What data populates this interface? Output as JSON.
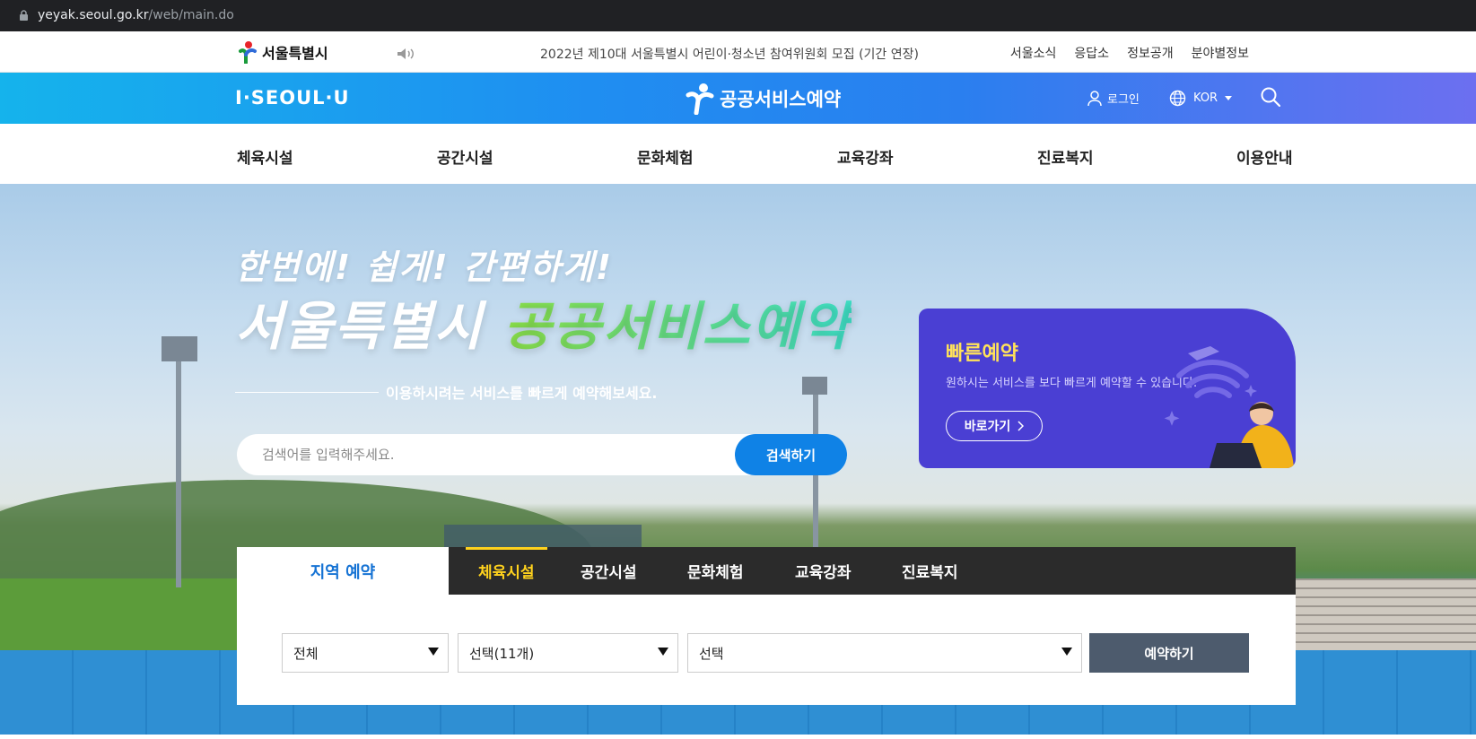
{
  "browser": {
    "url_host": "yeyak.seoul.go.kr",
    "url_path": "/web/main.do"
  },
  "topbar": {
    "logo_text": "서울특별시",
    "notice": "2022년 제10대 서울특별시 어린이·청소년 참여위원회 모집 (기간 연장)",
    "links": [
      "서울소식",
      "응답소",
      "정보공개",
      "분야별정보"
    ]
  },
  "header": {
    "left_logo": "I·SEOUL·U",
    "brand": "공공서비스예약",
    "login": "로그인",
    "lang": "KOR"
  },
  "gnb": [
    "체육시설",
    "공간시설",
    "문화체험",
    "교육강좌",
    "진료복지",
    "이용안내"
  ],
  "hero": {
    "slogan_top": "한번에! 쉽게! 간편하게!",
    "slogan_main": "서울특별시",
    "slogan_highlight": "공공서비스예약",
    "subline": "이용하시려는 서비스를 빠르게 예약해보세요.",
    "search_placeholder": "검색어를 입력해주세요.",
    "search_button": "검색하기"
  },
  "quick": {
    "title": "빠른예약",
    "desc": "원하시는 서비스를 보다 빠르게 예약할 수 있습니다.",
    "button": "바로가기"
  },
  "region_panel": {
    "region_tab": "지역 예약",
    "tabs": [
      "체육시설",
      "공간시설",
      "문화체험",
      "교육강좌",
      "진료복지"
    ],
    "active_tab": "체육시설",
    "select_area": "전체",
    "select_category": "선택(11개)",
    "select_facility": "선택",
    "reserve_button": "예약하기"
  },
  "colors": {
    "accent_blue": "#0f82e6",
    "quick_purple": "#4a3fd3",
    "active_tab_yellow": "#ffd21d"
  }
}
